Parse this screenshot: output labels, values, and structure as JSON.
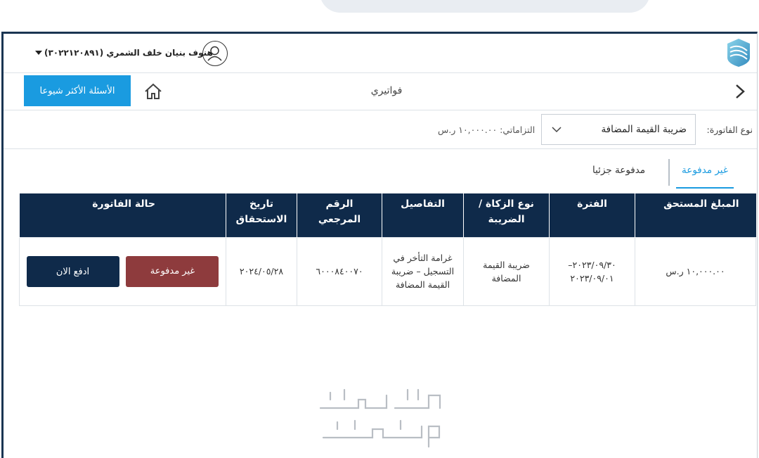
{
  "header": {
    "user_name": "هنوف بنيان خلف الشمري (٣٠٢٢١٢٠٨٩١)"
  },
  "breadcrumb": {
    "faq_label": "الأسئلة الأكثر شيوعا",
    "page_title": "فواتيري"
  },
  "filter": {
    "label": "نوع الفاتورة:",
    "selected_value": "ضريبة القيمة المضافة",
    "commitment": "التزاماتي: ١٠,٠٠٠.٠٠ ر.س"
  },
  "tabs": [
    {
      "label": "غير مدفوعة",
      "active": true
    },
    {
      "label": "مدفوعة جزئيا",
      "active": false
    }
  ],
  "table": {
    "headers": {
      "amount": "المبلغ المستحق",
      "period": "الفترة",
      "type": "نوع الزكاة / الضريبة",
      "details": "التفاصيل",
      "reference": "الرقم المرجعي",
      "due_date": "تاريخ الاستحقاق",
      "status": "حالة الفاتورة"
    },
    "rows": [
      {
        "amount": "١٠,٠٠٠.٠٠ ر.س",
        "period": "٢٠٢٣/٠٩/٣٠– ٢٠٢٣/٠٩/٠١",
        "type": "ضريبة القيمة المضافة",
        "details": "غرامة التأخر في التسجيل – ضريبة القيمة المضافة",
        "reference": "٦٠٠٠٨٤٠٠٧٠",
        "due_date": "٢٠٢٤/٠٥/٢٨",
        "status": "غير مدفوعة",
        "pay_label": "ادفع الان"
      }
    ]
  },
  "colors": {
    "primary_dark": "#0f2a4a",
    "accent_blue": "#1a9be0",
    "unpaid_red": "#8e3b3d"
  },
  "icons": [
    "logo-icon",
    "user-avatar-icon",
    "dropdown-caret-icon",
    "home-icon",
    "chevron-right-icon",
    "chevron-down-icon"
  ]
}
